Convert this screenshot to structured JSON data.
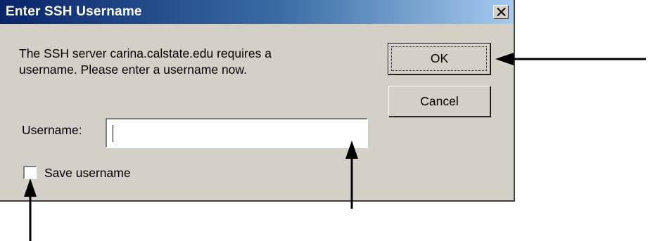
{
  "dialog": {
    "title": "Enter SSH Username",
    "message_line1": "The SSH server carina.calstate.edu requires a",
    "message_line2": "username.  Please enter a username now.",
    "ok_label": "OK",
    "cancel_label": "Cancel",
    "username_label": "Username:",
    "username_value": "",
    "save_username_label": "Save username",
    "save_username_checked": false,
    "close_icon": "close-icon"
  },
  "colors": {
    "titlebar_start": "#0a246a",
    "titlebar_end": "#a6caf0",
    "dialog_face": "#d4d0c8",
    "annotation_arrow": "#000000"
  }
}
